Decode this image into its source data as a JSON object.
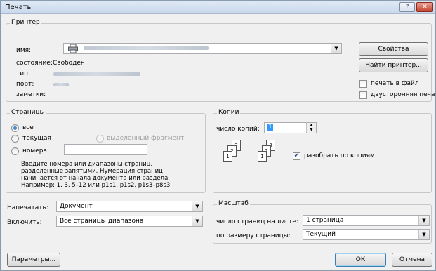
{
  "window": {
    "title": "Печать",
    "help_glyph": "?",
    "close_glyph": "✕"
  },
  "printer": {
    "group_label": "Принтер",
    "name_label": "имя:",
    "status_label": "состояние:",
    "status_value": "Свободен",
    "type_label": "тип:",
    "port_label": "порт:",
    "comment_label": "заметки:",
    "properties_button": "Свойства",
    "find_printer_button": "Найти принтер...",
    "print_to_file_label": "печать в файл",
    "print_to_file_checked": false,
    "duplex_label": "двусторонняя печать",
    "duplex_checked": false
  },
  "pages": {
    "group_label": "Страницы",
    "all_label": "все",
    "current_label": "текущая",
    "selection_label": "выделенный фрагмент",
    "numbers_label": "номера:",
    "numbers_value": "",
    "selected_option": "all",
    "hint_lines": [
      "Введите номера или диапазоны страниц,",
      "разделенные запятыми. Нумерация страниц",
      "начинается от начала документа или раздела.",
      "Например: 1, 3, 5–12 или p1s1, p1s2, p1s3–p8s3"
    ]
  },
  "copies": {
    "group_label": "Копии",
    "count_label": "число копий:",
    "count_value": "1",
    "collate_label": "разобрать по копиям",
    "collate_checked": true,
    "page_icons": [
      "3",
      "2",
      "1",
      "3",
      "2",
      "1"
    ]
  },
  "print_what": {
    "label": "Напечатать:",
    "value": "Документ"
  },
  "include": {
    "label": "Включить:",
    "value": "Все страницы диапазона"
  },
  "zoom": {
    "group_label": "Масштаб",
    "pages_per_sheet_label": "число страниц на листе:",
    "pages_per_sheet_value": "1 страница",
    "scale_to_label": "по размеру страницы:",
    "scale_to_value": "Текущий"
  },
  "footer": {
    "options_button": "Параметры...",
    "ok_button": "ОК",
    "cancel_button": "Отмена"
  },
  "icons": {
    "printer": "printer-icon",
    "dropdown": "chevron-down-icon",
    "checkmark": "checkmark-icon"
  },
  "colors": {
    "accent": "#3c7fb1",
    "titlebar": "#c9d8ec",
    "close": "#c5432e"
  }
}
